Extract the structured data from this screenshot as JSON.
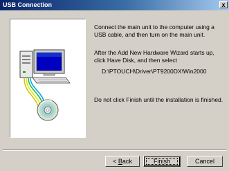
{
  "window": {
    "title": "USB Connection",
    "close_label": "x"
  },
  "content": {
    "instruction_1": "Connect the main unit to the computer using a USB cable, and then turn on the main unit.",
    "instruction_2": "After the Add New Hardware Wizard starts up, click Have Disk, and then select",
    "driver_path": "D:\\PTOUCH\\Driver\\PT9200DX\\Win2000",
    "instruction_3": "Do not click Finish until the installation is finished."
  },
  "buttons": {
    "back_prefix": "< ",
    "back_accel": "B",
    "back_rest": "ack",
    "finish": "Finish",
    "cancel": "Cancel"
  },
  "icons": {
    "computer": "computer-icon",
    "cd": "cd-disc-icon",
    "cable": "usb-cable-icon"
  }
}
